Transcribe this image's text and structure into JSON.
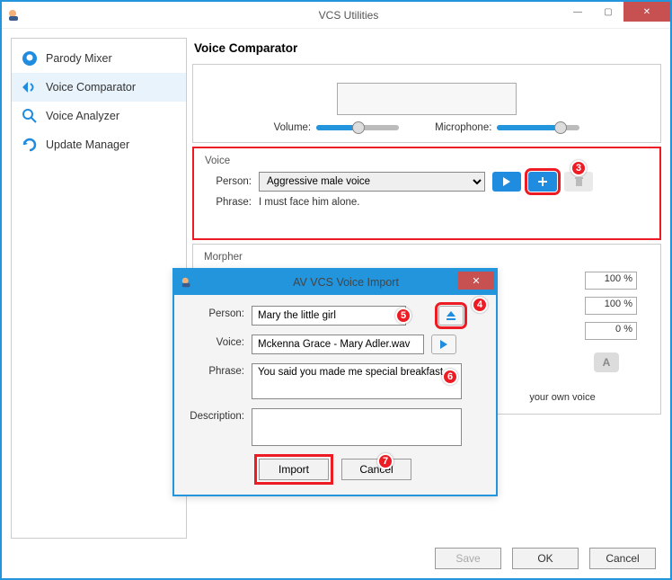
{
  "window": {
    "title": "VCS Utilities",
    "minimize": "—",
    "maximize": "▢",
    "close": "✕"
  },
  "sidebar": {
    "items": [
      {
        "label": "Parody Mixer",
        "icon": "parody-mixer-icon"
      },
      {
        "label": "Voice Comparator",
        "icon": "voice-comparator-icon"
      },
      {
        "label": "Voice Analyzer",
        "icon": "voice-analyzer-icon"
      },
      {
        "label": "Update Manager",
        "icon": "update-manager-icon"
      }
    ]
  },
  "main": {
    "title": "Voice Comparator",
    "volume_label": "Volume:",
    "mic_label": "Microphone:",
    "voice_section": {
      "legend": "Voice",
      "person_label": "Person:",
      "person_value": "Aggressive male voice",
      "phrase_label": "Phrase:",
      "phrase_value": "I must face him alone."
    },
    "morpher": {
      "legend": "Morpher",
      "pct": [
        "100 %",
        "100 %",
        "0 %"
      ],
      "a_label": "A",
      "own_voice": "your own voice"
    }
  },
  "dialog": {
    "title": "AV VCS Voice Import",
    "close": "✕",
    "person_label": "Person:",
    "person_value": "Mary the little girl",
    "voice_label": "Voice:",
    "voice_value": "Mckenna Grace - Mary Adler.wav",
    "phrase_label": "Phrase:",
    "phrase_value": "You said you made me special breakfast",
    "desc_label": "Description:",
    "desc_value": "",
    "import_btn": "Import",
    "cancel_btn": "Cancel"
  },
  "buttons": {
    "save": "Save",
    "ok": "OK",
    "cancel": "Cancel"
  },
  "callouts": {
    "c3": "3",
    "c4": "4",
    "c5": "5",
    "c6": "6",
    "c7": "7"
  }
}
